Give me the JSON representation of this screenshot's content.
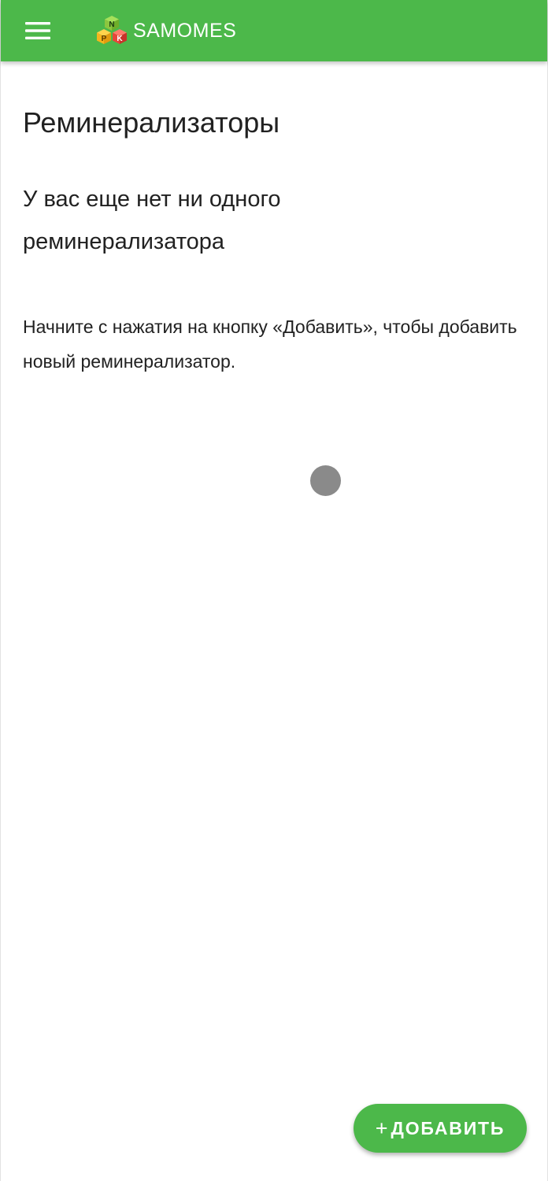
{
  "app_bar": {
    "menu_icon": "hamburger-menu-icon",
    "logo_letters": {
      "top": "N",
      "left": "P",
      "right": "K"
    },
    "brand_name": "SAMOMES",
    "color": "#4cb84a"
  },
  "main": {
    "title": "Реминерализаторы",
    "empty_title": "У вас еще нет ни одного реминерализатора",
    "empty_description": "Начните с нажатия на кнопку «Добавить», чтобы добавить новый реминерализатор."
  },
  "fab": {
    "icon": "+",
    "label": "ДОБАВИТЬ",
    "color": "#4cb84a"
  }
}
